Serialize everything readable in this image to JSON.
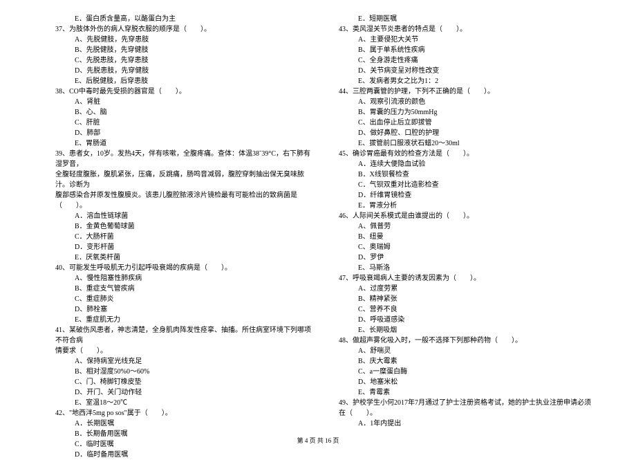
{
  "left": {
    "pre_opt": "E．蛋白质含量高，以酪蛋白为主",
    "q37": {
      "stem": "37、为肢体外伤的病人穿脱衣服的顺序是（　　）。",
      "opts": [
        "A、先脱健肢，先穿患肢",
        "B、先脱健肢，先穿健肢",
        "C、先脱患肢，先穿患肢",
        "D、先脱患肢，先穿健肢",
        "E、后脱健肢，后穿患肢"
      ]
    },
    "q38": {
      "stem": "38、CO中毒时最先受损的器官是（　　）。",
      "opts": [
        "A、肾脏",
        "B、心、脑",
        "C、肝脏",
        "D、肺部",
        "E、胃肠道"
      ]
    },
    "q39": {
      "stem": "39、患者女，10岁。发热4天，伴有咳嗽，全腹疼痛。查体：体温38˜39°C，右下肺有湿罗音，",
      "cont1": "全腹轻度腹胀，腹肌紧张，压痛，反跳痛，肠鸣音减弱，腹腔穿刺抽出保无臭味脓汁。诊断为",
      "cont2": "腹部感染合并原发性腹膜炎。该患儿腹腔脓液涂片镜检最有可能检出的致病菌是（　　）。",
      "opts": [
        "A．溶血性链球菌",
        "B．金黄色葡萄球菌",
        "C．大肠杆菌",
        "D．变形杆菌",
        "E．厌氧类杆菌"
      ]
    },
    "q40": {
      "stem": "40、可能发生呼吸肌无力引起呼吸衰竭的疾病是（　　）。",
      "opts": [
        "A、慢性阻塞性肺疾病",
        "B、重症支气管疾病",
        "C、重症肺炎",
        "D、肺栓塞",
        "E、重症肌无力"
      ]
    },
    "q41": {
      "stem": "41、某破伤风患者，神志清楚，全身肌肉阵发性痉挛、抽搐。所住病室环境下列哪项不符合病",
      "cont1": "情要求（　　）。",
      "opts": [
        "A、保持病室光线充足",
        "B、相对湿度50%0～60%",
        "C、门、椅脚钉橡皮垫",
        "D、开门、关门动作轻",
        "E、室温18～20℃"
      ]
    },
    "q42": {
      "stem": "42、\"地西泮5mg po sos\"属于（　　）。",
      "opts": [
        "A．长期医嘱",
        "B．长期备用医嘱",
        "C．临时医嘱",
        "D．临时备用医嘱"
      ]
    }
  },
  "right": {
    "pre_opt": "E．短期医嘱",
    "q43": {
      "stem": "43、类风湿关节炎患者的特点是（　　）。",
      "opts": [
        "A、主要侵犯大关节",
        "B、属于单系统性疾病",
        "C、全身游走性疼痛",
        "D、关节病变呈对称性改变",
        "E、发病者男女之比为1：2"
      ]
    },
    "q44": {
      "stem": "44、三腔两囊管的护理，下列不正确的是（　　）。",
      "opts": [
        "A、观察引流液的颜色",
        "B、胃囊的压力为50mmHg",
        "C、出血停止后立即拔管",
        "D、做好鼻腔、口腔的护理",
        "E、拔管前口服液状石蜡20～30ml"
      ]
    },
    "q45": {
      "stem": "45、确诊胃癌最有效的检查方法是（　　）。",
      "opts": [
        "A．连续大便隐血试验",
        "B．X线钡餐检查",
        "C．气钡双重对比造影检查",
        "D．纤维胃镜检查",
        "E．胃液分析"
      ]
    },
    "q46": {
      "stem": "46、人际间关系模式是由谁提出的（　　）。",
      "opts": [
        "A、佩普劳",
        "B、纽曼",
        "C、奥瑞姆",
        "D、罗伊",
        "E、马斯洛"
      ]
    },
    "q47": {
      "stem": "47、呼吸衰竭病人主要的诱发因素为（　　）。",
      "opts": [
        "A、过度劳累",
        "B、精神紧张",
        "C、营养不良",
        "D、呼吸道感染",
        "E、长期吸烟"
      ]
    },
    "q48": {
      "stem": "48、做超声雾化吸入时，一般不选择下列那种药物（　　）。",
      "opts": [
        "A、舒喘灵",
        "B、庆大霉素",
        "C、a一糜蛋白酶",
        "D、地塞米松",
        "E、青霉素"
      ]
    },
    "q49": {
      "stem": "49、护校学生小何2017年7月通过了护士注册资格考试，她的护士执业注册申请必须在（　　）。",
      "opts": [
        "A．1年内提出"
      ]
    }
  },
  "footer": "第 4 页 共 16 页"
}
